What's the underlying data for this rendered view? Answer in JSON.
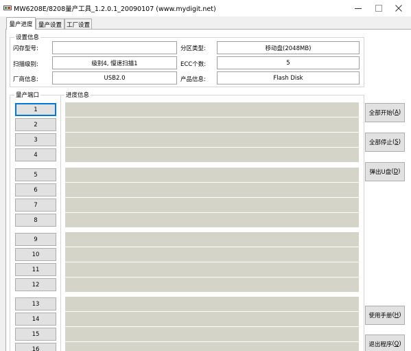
{
  "window": {
    "title": "MW6208E/8208量产工具_1.2.0.1_20090107 (www.mydigit.net)",
    "icon": "app-icon",
    "controls": [
      "minimize-icon",
      "maximize-icon",
      "close-icon"
    ]
  },
  "tabs": [
    {
      "label": "量产进度",
      "active": true
    },
    {
      "label": "量产设置",
      "active": false
    },
    {
      "label": "工厂设置",
      "active": false
    }
  ],
  "settings": {
    "group_title": "设置信息",
    "flash_model": {
      "label": "闪存型号:",
      "value": ""
    },
    "partition_type": {
      "label": "分区类型:",
      "value": "移动盘(2048MB)"
    },
    "scan_level": {
      "label": "扫描级别:",
      "value": "级别4, 慢速扫描1"
    },
    "ecc_count": {
      "label": "ECC个数:",
      "value": "5"
    },
    "vendor_info": {
      "label": "厂商信息:",
      "value": "USB2.0"
    },
    "product_info": {
      "label": "产品信息:",
      "value": "Flash Disk"
    }
  },
  "ports": {
    "header": "量产端口",
    "progress_header": "进度信息",
    "items": [
      {
        "label": "1",
        "progress": 0
      },
      {
        "label": "2",
        "progress": 0
      },
      {
        "label": "3",
        "progress": 0
      },
      {
        "label": "4",
        "progress": 0
      },
      {
        "label": "5",
        "progress": 0
      },
      {
        "label": "6",
        "progress": 0
      },
      {
        "label": "7",
        "progress": 0
      },
      {
        "label": "8",
        "progress": 0
      },
      {
        "label": "9",
        "progress": 0
      },
      {
        "label": "10",
        "progress": 0
      },
      {
        "label": "11",
        "progress": 0
      },
      {
        "label": "12",
        "progress": 0
      },
      {
        "label": "13",
        "progress": 0
      },
      {
        "label": "14",
        "progress": 0
      },
      {
        "label": "15",
        "progress": 0
      },
      {
        "label": "16",
        "progress": 0
      }
    ]
  },
  "actions": {
    "start_all": {
      "label": "全部开始",
      "mnemonic": "A"
    },
    "stop_all": {
      "label": "全部停止",
      "mnemonic": "S"
    },
    "eject_disk": {
      "label": "弹出U盘",
      "mnemonic": "D"
    },
    "manual": {
      "label": "使用手册",
      "mnemonic": "H"
    },
    "exit": {
      "label": "退出程序",
      "mnemonic": "Q"
    }
  },
  "colors": {
    "progress_track": "#d4d4c8",
    "progress_fill": "#06b025",
    "focus": "#0078d7",
    "button_face": "#e1e1e1"
  }
}
